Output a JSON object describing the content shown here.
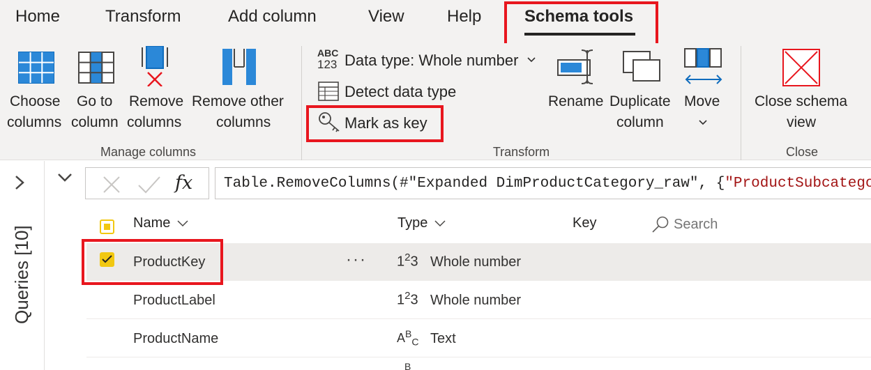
{
  "tabs": [
    "Home",
    "Transform",
    "Add column",
    "View",
    "Help",
    "Schema tools"
  ],
  "active_tab": "Schema tools",
  "ribbon": {
    "manage_columns": {
      "label": "Manage columns",
      "choose_columns": [
        "Choose",
        "columns"
      ],
      "go_to_column": [
        "Go to",
        "column"
      ],
      "remove_columns": [
        "Remove",
        "columns"
      ],
      "remove_other_columns": [
        "Remove other",
        "columns"
      ]
    },
    "transform": {
      "label": "Transform",
      "data_type_icon": [
        "ABC",
        "123"
      ],
      "data_type": "Data type: Whole number",
      "detect_data_type": "Detect data type",
      "mark_as_key": "Mark as key",
      "rename": "Rename",
      "duplicate_column": [
        "Duplicate",
        "column"
      ],
      "move": "Move"
    },
    "close": {
      "label": "Close",
      "close_schema_view": [
        "Close schema",
        "view"
      ]
    }
  },
  "sidebar": {
    "title": "Queries [10]"
  },
  "formula": {
    "fx": "fx",
    "text_prefix": "Table.RemoveColumns(#\"Expanded DimProductCategory_raw\", {",
    "text_string": "\"ProductSubcategory"
  },
  "grid": {
    "headers": {
      "name": "Name",
      "type": "Type",
      "key": "Key",
      "search_placeholder": "Search"
    },
    "rows": [
      {
        "name": "ProductKey",
        "type_icon": "123",
        "type": "Whole number",
        "selected": true
      },
      {
        "name": "ProductLabel",
        "type_icon": "123",
        "type": "Whole number",
        "selected": false
      },
      {
        "name": "ProductName",
        "type_icon": "ABC",
        "type": "Text",
        "selected": false
      }
    ],
    "more_options": "···"
  },
  "colors": {
    "accent_blue": "#0f6cbd",
    "highlight_red": "#e8161e",
    "checkbox_yellow": "#f2c811",
    "ribbon_bg": "#f3f2f1"
  }
}
